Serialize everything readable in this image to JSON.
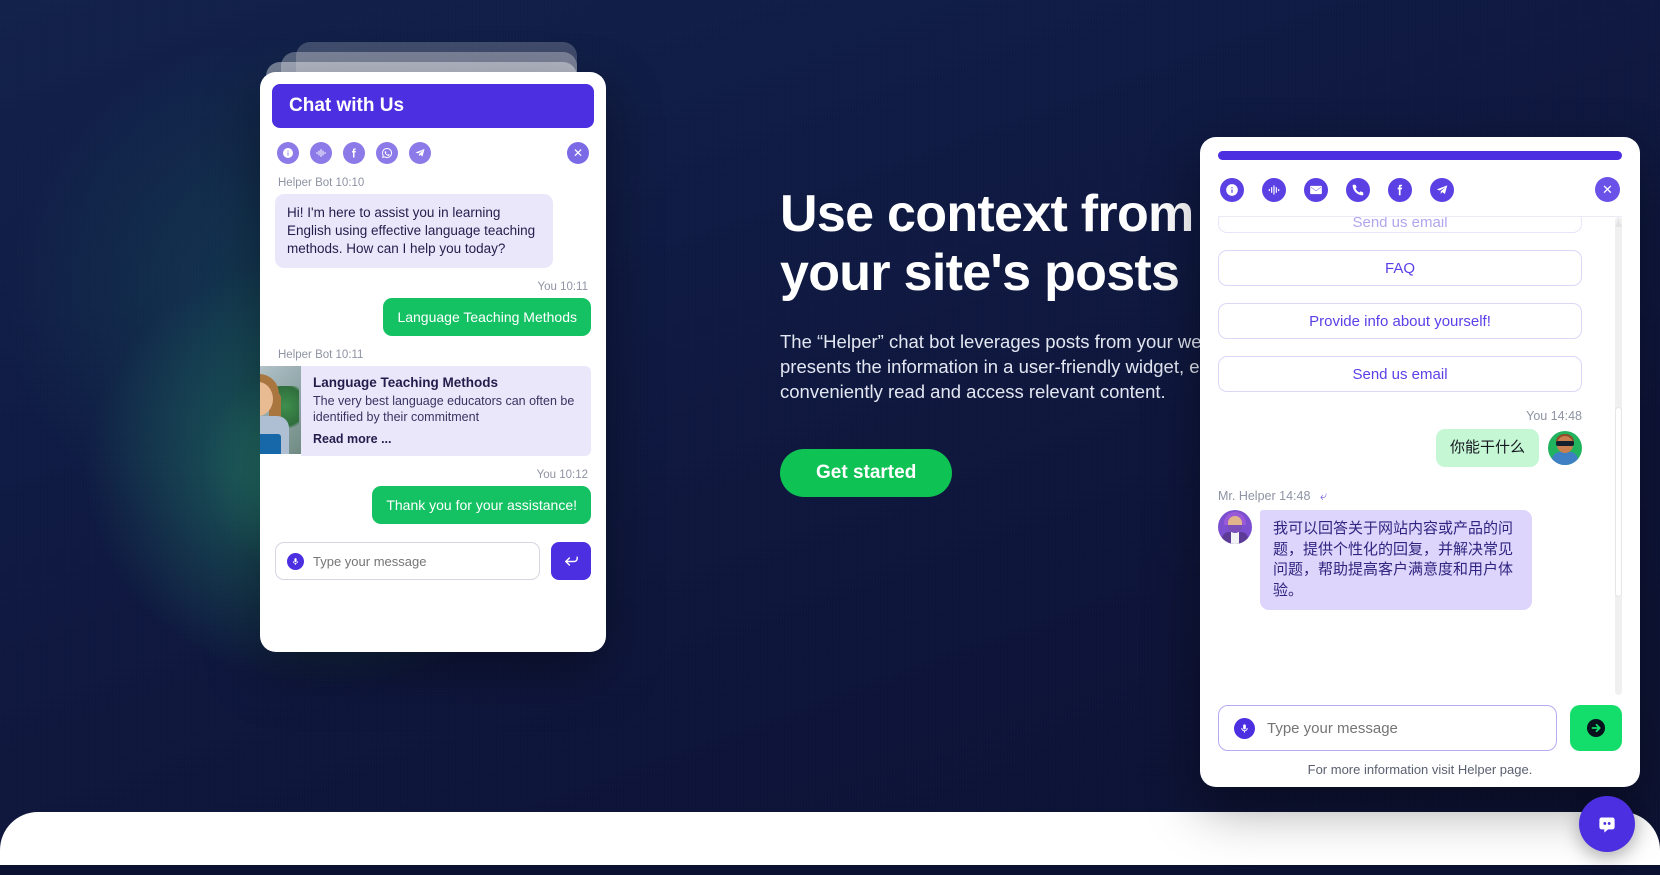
{
  "hero": {
    "title_line1": "Use context from",
    "title_line2": "your site's posts",
    "paragraph": "The “Helper” chat bot leverages posts from your website and presents the information in a user-friendly widget, enabling users to conveniently read and access relevant content.",
    "cta_label": "Get started"
  },
  "left_widget": {
    "header_title": "Chat with Us",
    "icons": [
      "info-icon",
      "voice-icon",
      "facebook-icon",
      "whatsapp-icon",
      "telegram-icon"
    ],
    "close_label": "✕",
    "messages": [
      {
        "meta": "Helper Bot 10:10",
        "text": "Hi! I'm here to assist you in learning English using effective language teaching methods. How can I help you today?"
      },
      {
        "meta": "You 10:11",
        "text": "Language Teaching Methods"
      },
      {
        "meta": "Helper Bot 10:11"
      },
      {
        "meta": "You 10:12",
        "text": "Thank you for your assistance!"
      }
    ],
    "post_card": {
      "title": "Language Teaching Methods",
      "description": "The very best language educators can often be identified by their commitment",
      "read_more": "Read more ..."
    },
    "input_placeholder": "Type your message",
    "send_icon": "enter-return-icon",
    "mic_icon": "microphone-icon"
  },
  "right_widget": {
    "icons": [
      "info-icon",
      "voice-icon",
      "email-icon",
      "phone-icon",
      "facebook-icon",
      "telegram-icon"
    ],
    "close_label": "✕",
    "quick_replies": [
      {
        "label": "Send us email",
        "faded": true
      },
      {
        "label": "FAQ",
        "faded": false
      },
      {
        "label": "Provide info about yourself!",
        "faded": false
      },
      {
        "label": "Send us email",
        "faded": false
      }
    ],
    "user_message": {
      "meta": "You 14:48",
      "text": "你能干什么"
    },
    "bot_message": {
      "meta": "Mr. Helper 14:48",
      "reply_icon": "reply-arrow-icon",
      "text": "我可以回答关于网站内容或产品的问题，提供个性化的回复，并解决常见问题，帮助提高客户满意度和用户体验。"
    },
    "input_placeholder": "Type your message",
    "send_icon": "arrow-right-circle-icon",
    "mic_icon": "microphone-icon",
    "footer_note": "For more information visit Helper page."
  },
  "launcher": {
    "icon": "chat-bot-icon"
  },
  "colors": {
    "brand_purple": "#4b2fe0",
    "accent_green": "#0ec254",
    "bubble_green": "#14c263",
    "bubble_purple": "#eae7fb",
    "page_dark": "#0b1130"
  }
}
